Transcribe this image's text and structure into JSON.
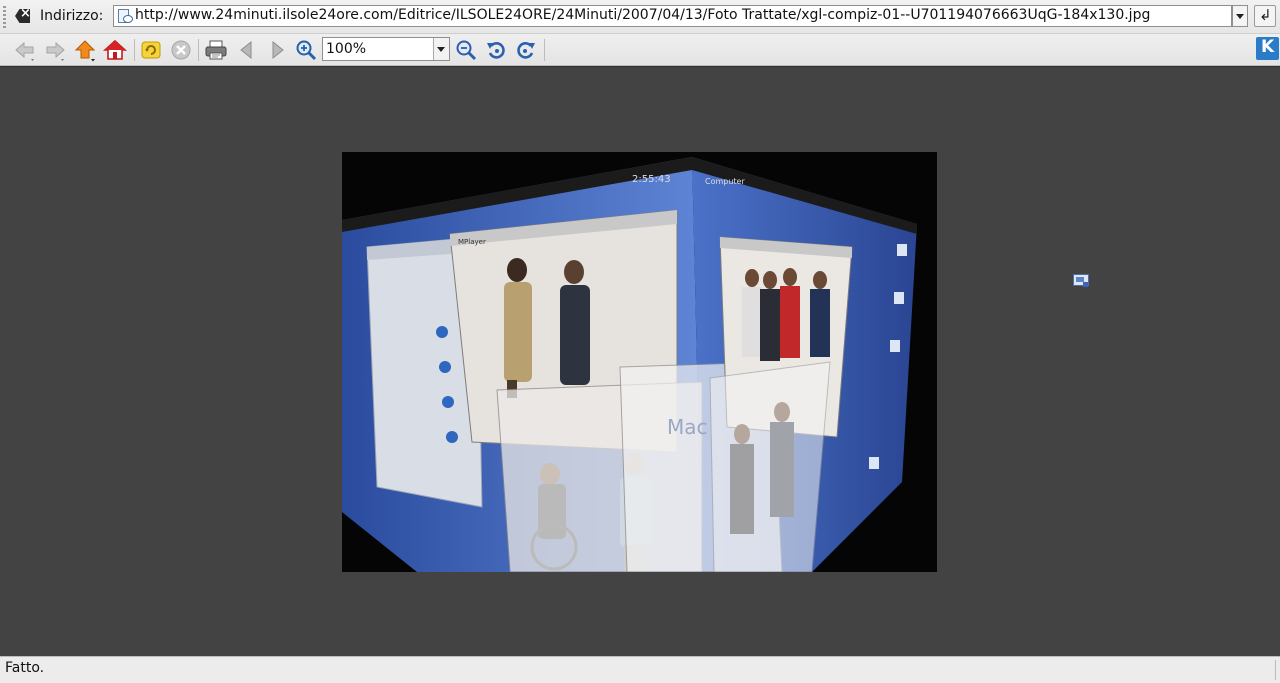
{
  "address_bar": {
    "label": "Indirizzo:",
    "url": "http://www.24minuti.ilsole24ore.com/Editrice/ILSOLE24ORE/24Minuti/2007/04/13/Foto Trattate/xgl-compiz-01--U701194076663UqG-184x130.jpg"
  },
  "toolbar": {
    "zoom_value": "100%",
    "buttons": [
      "back",
      "forward",
      "up",
      "home",
      "reload",
      "stop",
      "print",
      "previous",
      "next",
      "zoom-in",
      "zoom-out",
      "rotate-left",
      "rotate-right"
    ]
  },
  "image": {
    "cube_label_clock": "2:55:43",
    "cube_label_computer": "Computer",
    "cube_label_mplayer": "MPlayer",
    "cube_label_mac": "Mac"
  },
  "status_bar": {
    "text": "Fatto."
  },
  "colors": {
    "viewport_bg": "#434343",
    "chrome_bg": "#ececec",
    "cube_blue": "#3f63b8"
  }
}
